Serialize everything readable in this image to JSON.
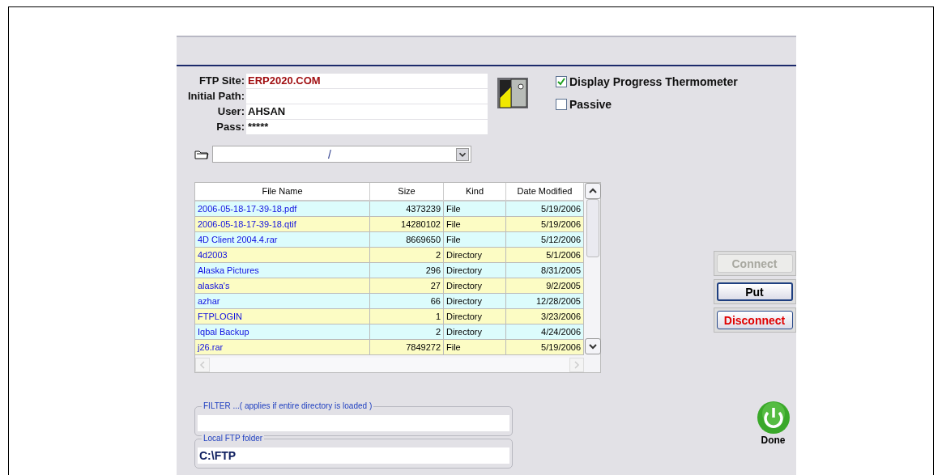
{
  "form": {
    "fields": [
      {
        "label": "FTP Site:",
        "value": "ERP2020.COM",
        "kind": "site"
      },
      {
        "label": "Initial Path:",
        "kind": "text"
      },
      {
        "label": "User:",
        "value": "AHSAN",
        "kind": "text"
      },
      {
        "label": "Pass:",
        "value": "*****",
        "kind": "text"
      }
    ]
  },
  "options": [
    {
      "label": "Display Progress Thermometer",
      "checked": true
    },
    {
      "label": "Passive",
      "checked": false
    }
  ],
  "path_combo": {
    "value": "/"
  },
  "table": {
    "columns": [
      "File Name",
      "Size",
      "Kind",
      "Date Modified"
    ],
    "rows": [
      [
        "2006-05-18-17-39-18.pdf",
        "4373239",
        "File",
        "5/19/2006"
      ],
      [
        "2006-05-18-17-39-18.qtif",
        "14280102",
        "File",
        "5/19/2006"
      ],
      [
        "4D Client 2004.4.rar",
        "8669650",
        "File",
        "5/12/2006"
      ],
      [
        "4d2003",
        "2",
        "Directory",
        "5/1/2006"
      ],
      [
        "Alaska Pictures",
        "296",
        "Directory",
        "8/31/2005"
      ],
      [
        "alaska's",
        "27",
        "Directory",
        "9/2/2005"
      ],
      [
        "azhar",
        "66",
        "Directory",
        "12/28/2005"
      ],
      [
        "FTPLOGIN",
        "1",
        "Directory",
        "3/23/2006"
      ],
      [
        "Iqbal Backup",
        "2",
        "Directory",
        "4/24/2006"
      ],
      [
        "j26.rar",
        "7849272",
        "File",
        "5/19/2006"
      ]
    ]
  },
  "buttons": [
    {
      "label": "Connect",
      "disabled": true,
      "kind": "normal"
    },
    {
      "label": "Put",
      "disabled": false,
      "kind": "default"
    },
    {
      "label": "Disconnect",
      "disabled": false,
      "kind": "danger"
    }
  ],
  "filter": {
    "legend": "FILTER ...( applies if entire directory is loaded )"
  },
  "local_folder": {
    "legend": "Local FTP folder",
    "value": "C:\\FTP"
  },
  "done": {
    "label": "Done"
  }
}
